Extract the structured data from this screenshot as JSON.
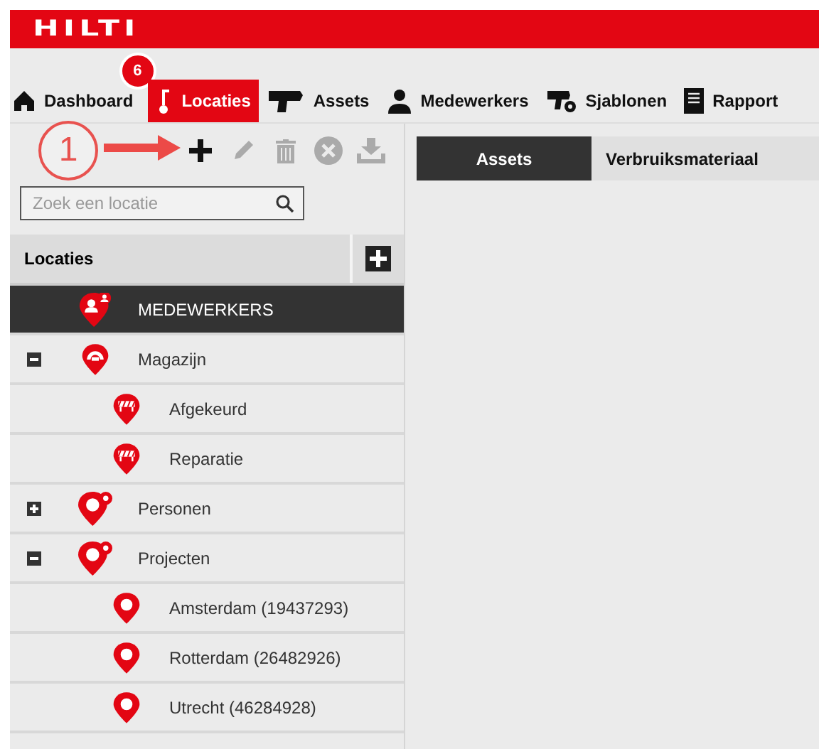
{
  "logo": "HILTI",
  "nav": [
    {
      "label": "Dashboard",
      "kind": "home",
      "selected": false
    },
    {
      "label": "Locaties",
      "kind": "pin",
      "selected": true,
      "badge": "6"
    },
    {
      "label": "Assets",
      "kind": "tool",
      "selected": false
    },
    {
      "label": "Medewerkers",
      "kind": "person",
      "selected": false
    },
    {
      "label": "Sjablonen",
      "kind": "tool-gear",
      "selected": false
    },
    {
      "label": "Rapport",
      "kind": "document",
      "selected": false
    }
  ],
  "annotation": {
    "label": "1"
  },
  "toolbar": [
    {
      "kind": "add",
      "disabled": false
    },
    {
      "kind": "edit",
      "disabled": true
    },
    {
      "kind": "delete",
      "disabled": true
    },
    {
      "kind": "cancel",
      "disabled": true
    },
    {
      "kind": "download",
      "disabled": true
    }
  ],
  "search": {
    "placeholder": "Zoek een locatie"
  },
  "tree_header": {
    "title": "Locaties"
  },
  "tree": [
    {
      "label": "MEDEWERKERS",
      "kind": "employees",
      "selected": true
    },
    {
      "label": "Magazijn",
      "kind": "warehouse",
      "selected": false,
      "expanded": true,
      "children": [
        {
          "label": "Afgekeurd",
          "kind": "barrier",
          "selected": false
        },
        {
          "label": "Reparatie",
          "kind": "barrier",
          "selected": false
        }
      ]
    },
    {
      "label": "Personen",
      "kind": "group",
      "selected": false,
      "expanded": false
    },
    {
      "label": "Projecten",
      "kind": "group",
      "selected": false,
      "expanded": true,
      "children": [
        {
          "label": "Amsterdam (19437293)",
          "kind": "pin",
          "selected": false
        },
        {
          "label": "Rotterdam (26482926)",
          "kind": "pin",
          "selected": false
        },
        {
          "label": "Utrecht (46284928)",
          "kind": "pin",
          "selected": false
        }
      ]
    }
  ],
  "content_tabs": [
    {
      "label": "Assets",
      "selected": true
    },
    {
      "label": "Verbruiksmateriaal",
      "selected": false
    }
  ]
}
